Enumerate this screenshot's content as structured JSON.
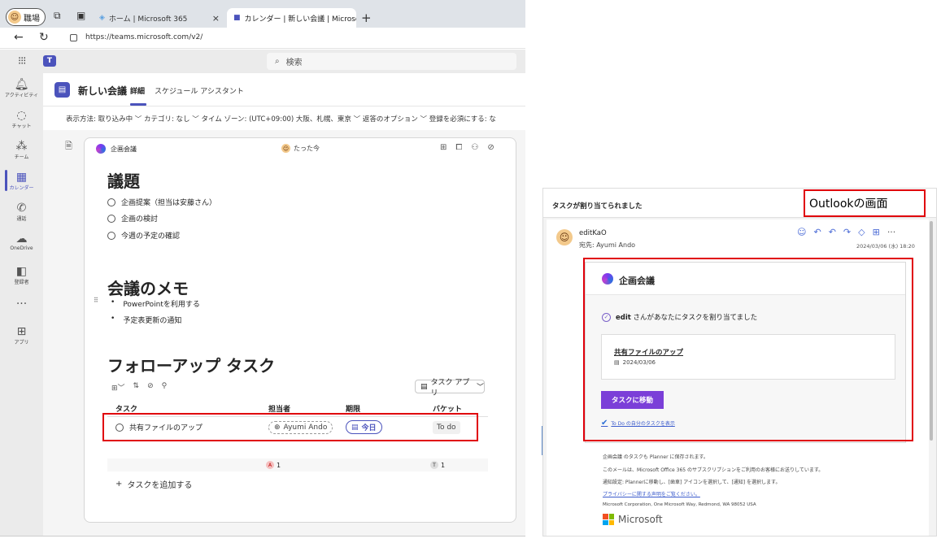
{
  "browser": {
    "profile_label": "職場",
    "tab_inactive_title": "ホーム | Microsoft 365",
    "tab_active_title": "カレンダー | 新しい会議 | Microsoft",
    "url": "https://teams.microsoft.com/v2/",
    "search_placeholder": "検索"
  },
  "rail": {
    "items": [
      {
        "label": "アクティビティ",
        "icon": "bell-icon"
      },
      {
        "label": "チャット",
        "icon": "chat-icon"
      },
      {
        "label": "チーム",
        "icon": "teams-icon"
      },
      {
        "label": "カレンダー",
        "icon": "calendar-icon"
      },
      {
        "label": "通話",
        "icon": "phone-icon"
      },
      {
        "label": "OneDrive",
        "icon": "cloud-icon"
      },
      {
        "label": "登録者",
        "icon": "registrant-icon"
      },
      {
        "label": "アプリ",
        "icon": "apps-icon"
      }
    ],
    "more": "···"
  },
  "meeting": {
    "title": "新しい会議",
    "tabs": [
      "詳細",
      "スケジュール アシスタント"
    ],
    "options_text": "表示方法: 取り込み中 ﹀  カテゴリ: なし ﹀  タイム ゾーン: (UTC+09:00) 大阪、札幌、東京 ﹀  返答のオプション ﹀    登録を必須にする: な"
  },
  "loop": {
    "name": "企画会議",
    "last_edit": "たった今",
    "agenda_heading": "議題",
    "agenda": [
      "企画提案（担当は安藤さん）",
      "企画の検討",
      "今週の予定の確認"
    ],
    "memo_heading": "会議のメモ",
    "memo": [
      "PowerPointを利用する",
      "予定表更新の通知"
    ],
    "follow_heading": "フォローアップ タスク",
    "task_app_button": "タスク アプリ",
    "columns": [
      "タスク",
      "担当者",
      "期限",
      "バケット"
    ],
    "task": {
      "title": "共有ファイルのアップ",
      "assignee": "Ayumi Ando",
      "due": "今日",
      "bucket": "To do"
    },
    "summary_assignee_count": "1",
    "summary_bucket_count": "1",
    "add_task": "タスクを追加する"
  },
  "outlook": {
    "subject": "タスクが割り当てられました",
    "caption": "Outlookの画面",
    "sender": "editKaO",
    "to": "宛先: Ayumi Ando",
    "date": "2024/03/06 (水) 18:20",
    "card_title": "企画会議",
    "assigned_by": "edit",
    "assigned_text": "さんがあなたにタスクを割り当てました",
    "task_title": "共有ファイルのアップ",
    "task_date": "2024/03/06",
    "go_button": "タスクに移動",
    "todo_link": "To Do の自分のタスクを表示",
    "footer": [
      "企画会議 のタスクも Planner に保存されます。",
      "このメールは、Microsoft Office 365 のサブスクリプションをご利用のお客様にお送りしています。",
      "通知設定: Plannerに移動し、[歯車] アイコンを選択して、[通知] を選択します。",
      "プライバシーに関する声明をご覧ください。",
      "Microsoft Corporation, One Microsoft Way, Redmond, WA 98052 USA"
    ],
    "brand": "Microsoft"
  },
  "colors": {
    "accent": "#4b53bc",
    "highlight": "#e0000b",
    "outlook_button": "#7b3fd8",
    "arrow": "#5b86c5"
  }
}
